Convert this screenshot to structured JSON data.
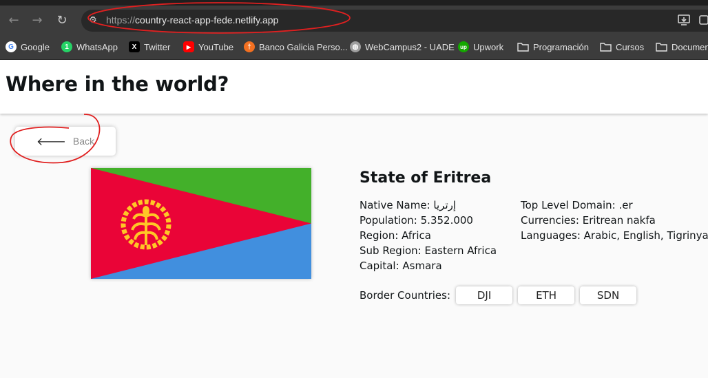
{
  "browser": {
    "url_scheme": "https://",
    "url_host": "country-react-app-fede.netlify.app",
    "bookmarks": [
      {
        "label": "Google",
        "icon": "google-icon",
        "color": "#ffffff"
      },
      {
        "label": "WhatsApp",
        "icon": "whatsapp-icon",
        "color": "#25d366"
      },
      {
        "label": "Twitter",
        "icon": "x-icon",
        "color": "#000000"
      },
      {
        "label": "YouTube",
        "icon": "youtube-icon",
        "color": "#ff0000"
      },
      {
        "label": "Banco Galicia Perso...",
        "icon": "galicia-icon",
        "color": "#f37021"
      },
      {
        "label": "WebCampus2 - UADE",
        "icon": "globe-icon",
        "color": "#9e9e9e"
      },
      {
        "label": "Upwork",
        "icon": "upwork-icon",
        "color": "#14a800"
      },
      {
        "label": "Programación",
        "icon": "folder-icon"
      },
      {
        "label": "Cursos",
        "icon": "folder-icon"
      },
      {
        "label": "Documen",
        "icon": "folder-icon"
      }
    ]
  },
  "header": {
    "title": "Where in the world?"
  },
  "back_button": {
    "label": "Back"
  },
  "country": {
    "name": "State of Eritrea",
    "native_name": "Native Name: إرتريا",
    "population": "Population: 5.352.000",
    "region": "Region: Africa",
    "sub_region": "Sub Region: Eastern Africa",
    "capital": "Capital: Asmara",
    "tld": "Top Level Domain: .er",
    "currencies": "Currencies: Eritrean nakfa",
    "languages": "Languages: Arabic, English, Tigrinya",
    "border_label": "Border Countries:",
    "borders": [
      "DJI",
      "ETH",
      "SDN"
    ],
    "flag_colors": {
      "green": "#43b02a",
      "red": "#ea0437",
      "blue": "#418fde",
      "emblem": "#ffc726"
    }
  },
  "annotation_color": "#e02020"
}
